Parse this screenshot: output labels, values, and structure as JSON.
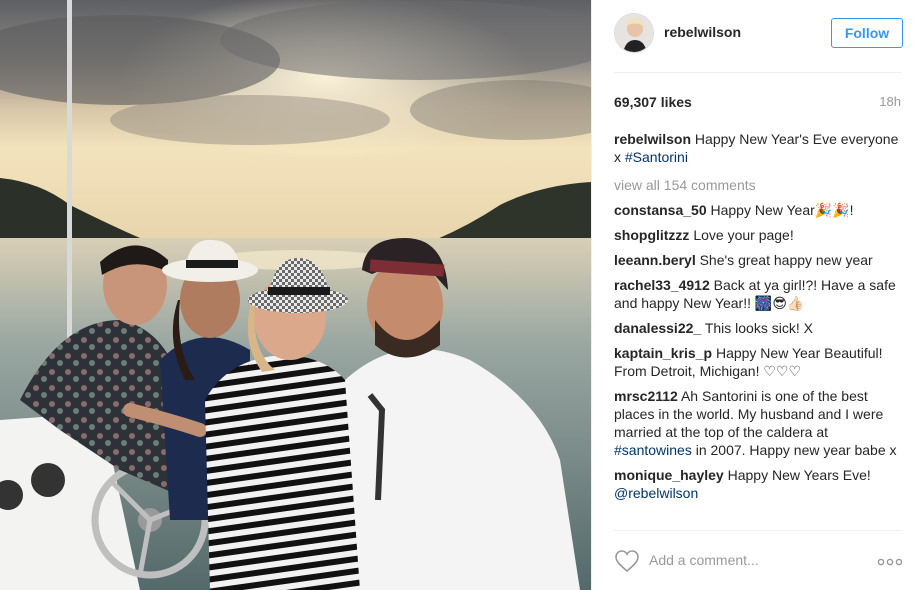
{
  "post": {
    "username": "rebelwilson",
    "follow_label": "Follow",
    "likes": "69,307 likes",
    "time": "18h",
    "caption": {
      "user": "rebelwilson",
      "text": "Happy New Year's Eve everyone x ",
      "hashtag": "#Santorini"
    },
    "view_all": "view all 154 comments",
    "comments": [
      {
        "user": "constansa_50",
        "text": "Happy New Year🎉🎉!"
      },
      {
        "user": "shopglitzzz",
        "text": "Love your page!"
      },
      {
        "user": "leeann.beryl",
        "text": "She's great happy new year"
      },
      {
        "user": "rachel33_4912",
        "text": "Back at ya girl!?! Have a safe and happy New Year!! 🎆😎👍🏻"
      },
      {
        "user": "danalessi22_",
        "text": "This looks sick! X"
      },
      {
        "user": "kaptain_kris_p",
        "text": "Happy New Year Beautiful! From Detroit, Michigan! ♡♡♡"
      },
      {
        "user": "mrsc2112",
        "text": "Ah Santorini is one of the best places in the world. My husband and I were married at the top of the caldera at ",
        "tag": "#santowines",
        "after": " in 2007. Happy new year babe x"
      },
      {
        "user": "monique_hayley",
        "text": "Happy New Years Eve! ",
        "tag": "@rebelwilson"
      }
    ],
    "add_comment_placeholder": "Add a comment...",
    "icons": {
      "like": "heart-icon",
      "more": "more-options-icon"
    },
    "colors": {
      "link": "#3897f0",
      "tag": "#003569",
      "muted": "#999999"
    }
  }
}
